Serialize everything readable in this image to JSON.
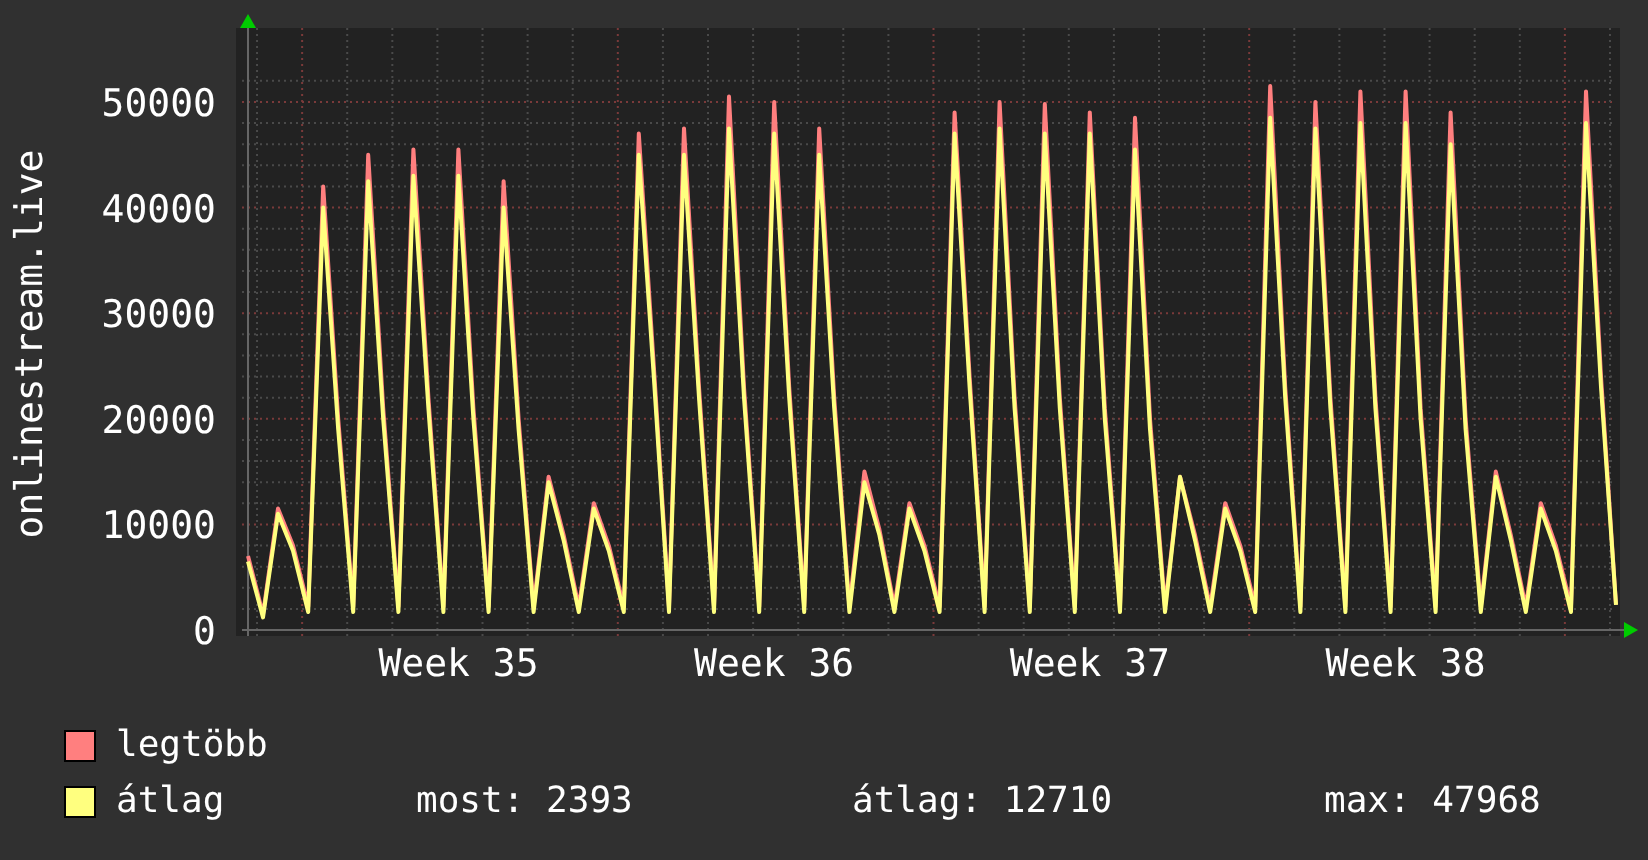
{
  "chart": {
    "chart_data": {
      "type": "line",
      "ylabel": "onlinestream.live",
      "categories": [
        null,
        null,
        null,
        null,
        null,
        null,
        null,
        null,
        null,
        null,
        null,
        null,
        null,
        null,
        "Week 35",
        null,
        null,
        null,
        null,
        null,
        null,
        null,
        null,
        null,
        null,
        null,
        null,
        null,
        null,
        null,
        null,
        null,
        null,
        null,
        null,
        "Week 36",
        null,
        null,
        null,
        null,
        null,
        null,
        null,
        null,
        null,
        null,
        null,
        null,
        null,
        null,
        null,
        null,
        null,
        null,
        null,
        null,
        "Week 37",
        null,
        null,
        null,
        null,
        null,
        null,
        null,
        null,
        null,
        null,
        null,
        null,
        null,
        null,
        null,
        null,
        null,
        null,
        null,
        null,
        "Week 38",
        null,
        null,
        null,
        null,
        null,
        null,
        null,
        null,
        null,
        null,
        null,
        null,
        null,
        null
      ],
      "series": [
        {
          "name": "legtöbb",
          "color": "#ff7f7f",
          "values": [
            7000,
            1500,
            11500,
            8000,
            2200,
            42000,
            20000,
            2200,
            45000,
            21000,
            2200,
            45500,
            22000,
            2200,
            45500,
            21000,
            2200,
            42500,
            20000,
            2200,
            14500,
            9000,
            2200,
            12000,
            8000,
            2200,
            47000,
            25000,
            2200,
            47500,
            23000,
            2200,
            50500,
            23000,
            2200,
            50000,
            23000,
            2200,
            47500,
            22000,
            2200,
            15000,
            9500,
            2200,
            12000,
            8000,
            2200,
            49000,
            24000,
            2200,
            50000,
            22000,
            2200,
            49800,
            22000,
            2200,
            49000,
            21000,
            2200,
            48500,
            20000,
            2200,
            14500,
            9000,
            2200,
            12000,
            8000,
            2200,
            51500,
            23000,
            2200,
            50000,
            22000,
            2200,
            51000,
            22000,
            2200,
            51000,
            21000,
            2200,
            49000,
            20000,
            2200,
            15000,
            9000,
            2200,
            12000,
            8000,
            2200,
            51000,
            24000,
            2400
          ]
        },
        {
          "name": "átlag",
          "color": "#ffff7f",
          "values": [
            6500,
            1200,
            11000,
            7500,
            1700,
            40000,
            19000,
            1700,
            42500,
            20000,
            1700,
            43000,
            21000,
            1700,
            43000,
            20000,
            1700,
            40000,
            19000,
            1700,
            14000,
            8500,
            1700,
            11500,
            7500,
            1700,
            45000,
            24000,
            1700,
            45000,
            22000,
            1700,
            47500,
            22000,
            1700,
            47000,
            22000,
            1700,
            45000,
            21000,
            1700,
            14000,
            9000,
            1700,
            11500,
            7500,
            1700,
            47000,
            23000,
            1700,
            47500,
            21000,
            1700,
            47000,
            21000,
            1700,
            47000,
            20000,
            1700,
            45500,
            19000,
            1700,
            14500,
            8500,
            1700,
            11500,
            7500,
            1700,
            48500,
            22000,
            1700,
            47500,
            21000,
            1700,
            48000,
            21000,
            1700,
            48000,
            20000,
            1700,
            46000,
            19000,
            1700,
            14500,
            8500,
            1700,
            11500,
            7500,
            1700,
            48000,
            23000,
            2393
          ]
        }
      ],
      "ylim": [
        0,
        52000
      ],
      "grid": true,
      "yticks": [
        0,
        10000,
        20000,
        30000,
        40000,
        50000
      ]
    }
  },
  "stats": [
    "most: 2393",
    "átlag: 12710",
    "max: 47968"
  ]
}
